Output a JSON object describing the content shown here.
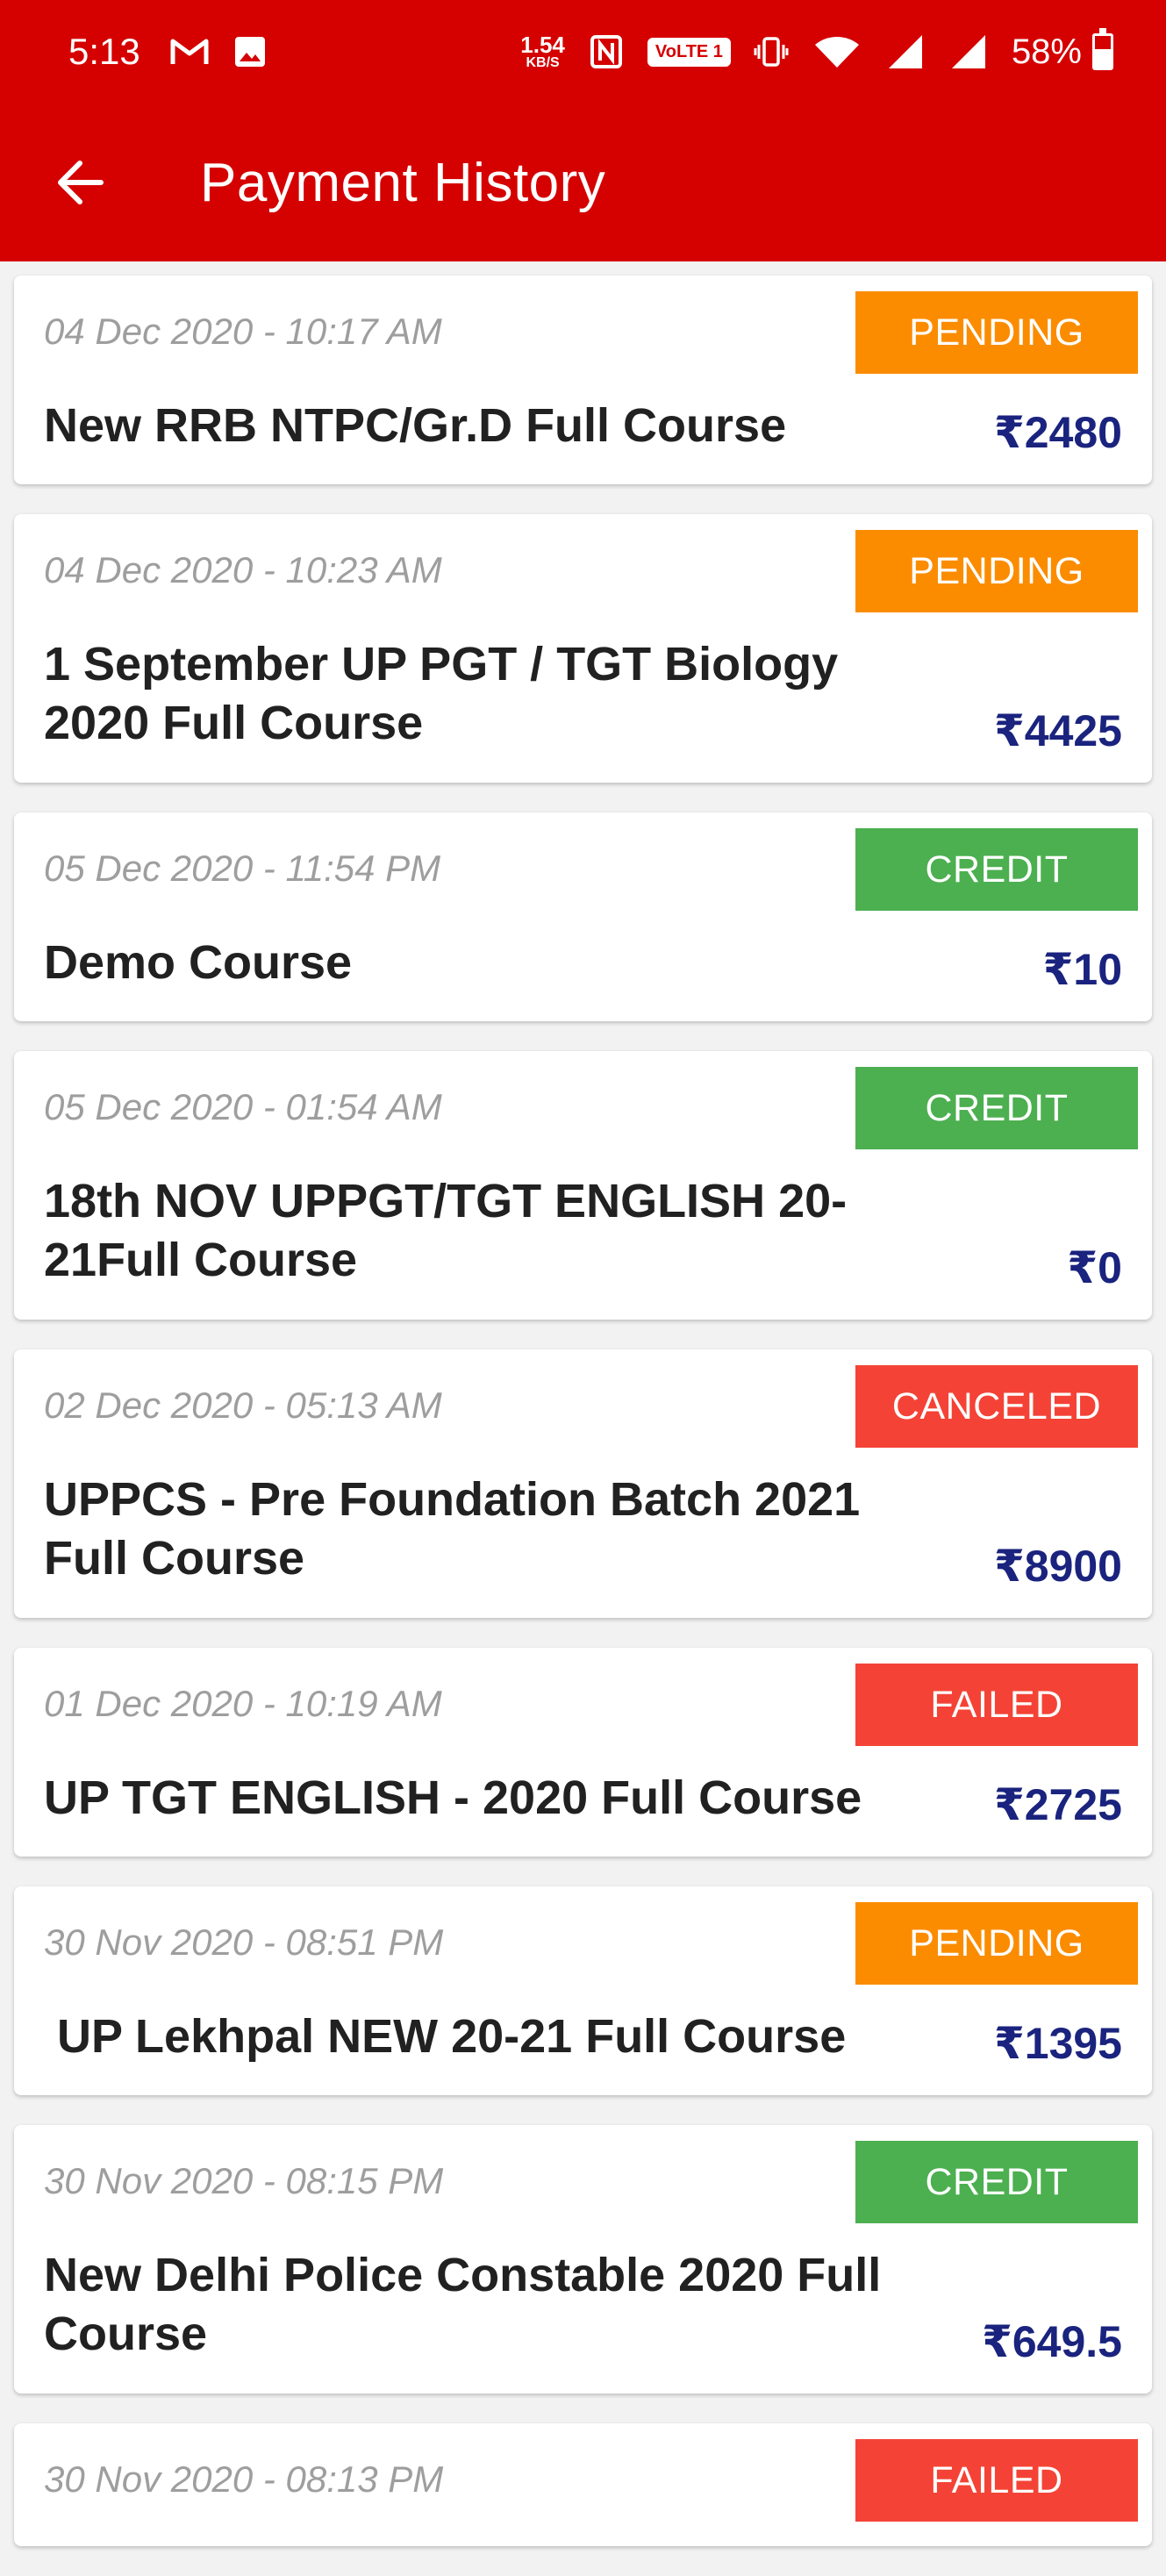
{
  "status_bar": {
    "time": "5:13",
    "net_speed_value": "1.54",
    "net_speed_unit": "KB/S",
    "volte": "VoLTE 1",
    "battery": "58%",
    "icons": [
      "gmail-icon",
      "image-icon",
      "nfc-icon",
      "vibrate-icon",
      "wifi-icon",
      "signal-icon",
      "signal-icon",
      "battery-icon"
    ]
  },
  "app_bar": {
    "title": "Payment History",
    "back_icon": "arrow-left-icon"
  },
  "colors": {
    "primary": "#d50000",
    "pending": "#fb8c00",
    "credit": "#4caf50",
    "failed": "#f44336",
    "amount": "#1a237e"
  },
  "payments": [
    {
      "date": "04 Dec 2020 - 10:17 AM",
      "status": "PENDING",
      "title": "New RRB NTPC/Gr.D Full Course",
      "amount": "₹2480"
    },
    {
      "date": "04 Dec 2020 - 10:23 AM",
      "status": "PENDING",
      "title": "1 September UP PGT / TGT Biology 2020 Full Course",
      "amount": "₹4425"
    },
    {
      "date": "05 Dec 2020 - 11:54 PM",
      "status": "CREDIT",
      "title": "Demo Course",
      "amount": "₹10"
    },
    {
      "date": "05 Dec 2020 - 01:54 AM",
      "status": "CREDIT",
      "title": "18th NOV UPPGT/TGT ENGLISH 20-21Full Course",
      "amount": "₹0"
    },
    {
      "date": "02 Dec 2020 - 05:13 AM",
      "status": "CANCELED",
      "title": "UPPCS - Pre Foundation Batch 2021 Full Course",
      "amount": "₹8900"
    },
    {
      "date": "01 Dec 2020 - 10:19 AM",
      "status": "FAILED",
      "title": "UP TGT ENGLISH - 2020 Full Course",
      "amount": "₹2725"
    },
    {
      "date": "30 Nov 2020 - 08:51 PM",
      "status": "PENDING",
      "title": " UP Lekhpal NEW 20-21 Full Course",
      "amount": "₹1395"
    },
    {
      "date": "30 Nov 2020 - 08:15 PM",
      "status": "CREDIT",
      "title": "New Delhi Police Constable 2020 Full Course",
      "amount": "₹649.5"
    },
    {
      "date": "30 Nov 2020 - 08:13 PM",
      "status": "FAILED"
    }
  ]
}
